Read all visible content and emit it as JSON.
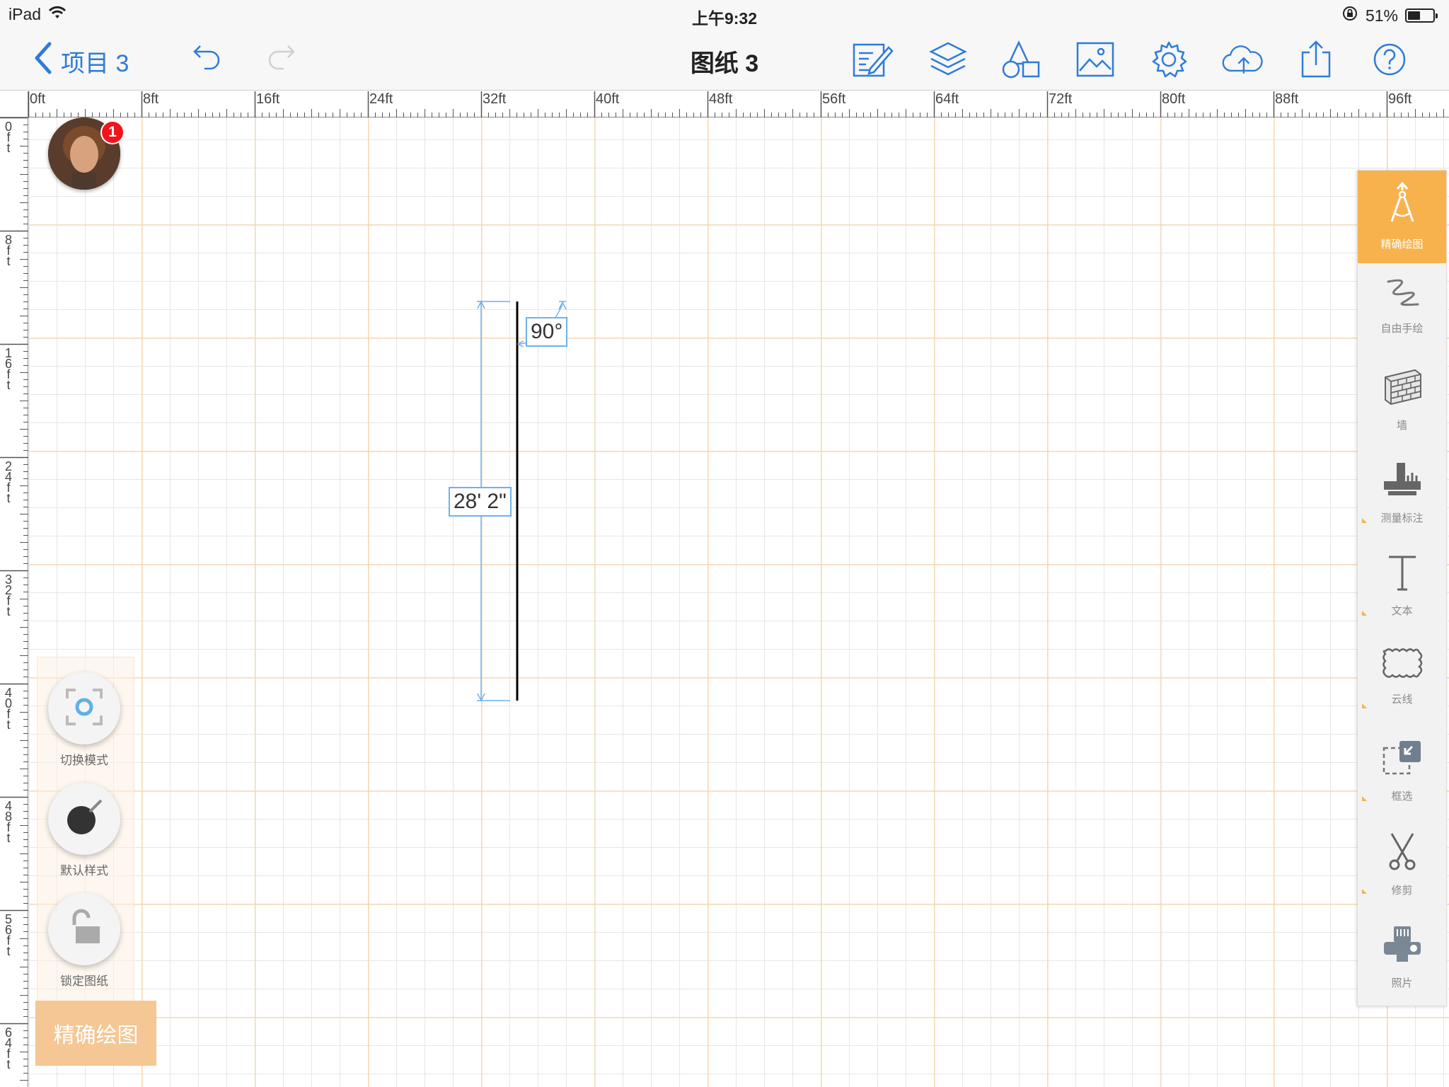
{
  "status_bar": {
    "device": "iPad",
    "time": "上午9:32",
    "battery": "51%",
    "battery_level": 0.51
  },
  "nav": {
    "back_label": "项目 3",
    "title": "图纸 3",
    "icons": [
      "undo-icon",
      "redo-icon",
      "edit-icon",
      "layers-icon",
      "shapes-icon",
      "image-icon",
      "settings-icon",
      "cloud-upload-icon",
      "share-icon",
      "help-icon"
    ]
  },
  "ruler": {
    "top_labels": [
      "0ft",
      "8ft",
      "16ft",
      "24ft",
      "32ft",
      "40ft",
      "48ft",
      "56ft",
      "64ft",
      "72ft",
      "80ft",
      "88ft",
      "96ft"
    ],
    "left_labels": [
      "0ft",
      "8ft",
      "16ft",
      "24ft",
      "32ft",
      "40ft",
      "48ft",
      "56ft",
      "64ft"
    ]
  },
  "user": {
    "notification_count": "1"
  },
  "drawing": {
    "length_label": "28' 2\"",
    "angle_label": "90°"
  },
  "left_panel": {
    "switch_mode": "切换模式",
    "default_style": "默认样式",
    "lock_drawing": "锁定图纸",
    "mode_button": "精确绘图"
  },
  "tools": [
    {
      "label": "精确绘图",
      "icon": "precision-draw-icon",
      "active": true
    },
    {
      "label": "自由手绘",
      "icon": "freehand-icon",
      "active": false
    },
    {
      "label": "墙",
      "icon": "wall-icon",
      "active": false
    },
    {
      "label": "测量标注",
      "icon": "measure-icon",
      "active": false
    },
    {
      "label": "文本",
      "icon": "text-icon",
      "active": false
    },
    {
      "label": "云线",
      "icon": "cloud-line-icon",
      "active": false
    },
    {
      "label": "框选",
      "icon": "box-select-icon",
      "active": false
    },
    {
      "label": "修剪",
      "icon": "trim-icon",
      "active": false
    },
    {
      "label": "照片",
      "icon": "photo-icon",
      "active": false
    }
  ],
  "colors": {
    "accent": "#2e7bd9",
    "tool_active": "#f7b24e",
    "dimension": "#6fb1ea",
    "badge": "#f0151c"
  }
}
